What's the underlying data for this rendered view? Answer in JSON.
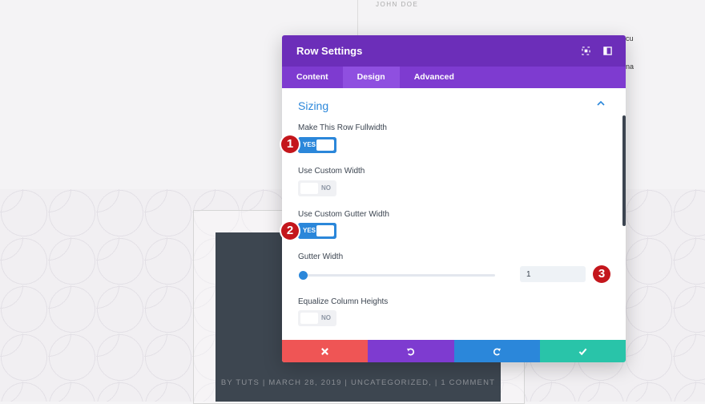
{
  "background": {
    "author": "JOHN DOE",
    "side_text_1": "cu",
    "side_text_2": "na",
    "byline": "BY TUTS | MARCH 28, 2019 | UNCATEGORIZED, | 1 COMMENT"
  },
  "modal": {
    "title": "Row Settings",
    "tabs": [
      {
        "label": "Content"
      },
      {
        "label": "Design"
      },
      {
        "label": "Advanced"
      }
    ],
    "active_tab": "Design",
    "section": {
      "title": "Sizing",
      "fields": {
        "fullwidth": {
          "label": "Make This Row Fullwidth",
          "state": "YES"
        },
        "custom_width": {
          "label": "Use Custom Width",
          "state": "NO"
        },
        "gutter_toggle": {
          "label": "Use Custom Gutter Width",
          "state": "YES"
        },
        "gutter_width": {
          "label": "Gutter Width",
          "value": "1",
          "slider_fraction": 0
        },
        "equalize": {
          "label": "Equalize Column Heights",
          "state": "NO"
        }
      }
    }
  },
  "badges": [
    "1",
    "2",
    "3"
  ],
  "colors": {
    "header": "#6c2eb9",
    "tabs": "#7e3bd0",
    "accent": "#2b87da",
    "cancel": "#ef5555",
    "undo": "#7e3bd0",
    "redo": "#2b87da",
    "save": "#29c4a9",
    "badge": "#c4161c"
  },
  "footer_icons": [
    "close-icon",
    "undo-icon",
    "redo-icon",
    "check-icon"
  ]
}
